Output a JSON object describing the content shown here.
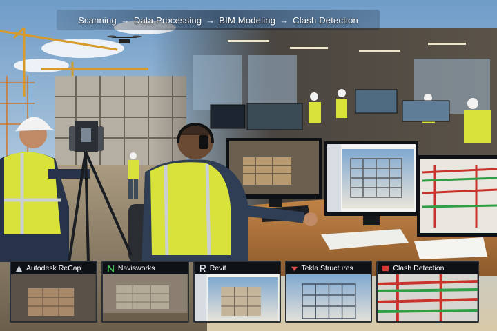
{
  "workflow": {
    "steps": [
      "Scanning",
      "Data Processing",
      "BIM Modeling",
      "Clash Detection"
    ],
    "arrow": "→"
  },
  "tiles": [
    {
      "label": "Autodesk ReCap",
      "icon": "recap-triangle-icon",
      "accent": "#cfd6dd"
    },
    {
      "label": "Navisworks",
      "icon": "navisworks-n-icon",
      "accent": "#3fb950"
    },
    {
      "label": "Revit",
      "icon": "revit-r-icon",
      "accent": "#e6ecf2"
    },
    {
      "label": "Tekla Structures",
      "icon": "tekla-icon",
      "accent": "#e0504a"
    },
    {
      "label": "Clash Detection",
      "icon": "clash-icon",
      "accent": "#d93a32"
    }
  ],
  "colors": {
    "sky": "#8fb4d6",
    "safety_vest": "#d8e23a",
    "steel_red": "#c8332b",
    "pipe_green": "#2f9e44"
  }
}
